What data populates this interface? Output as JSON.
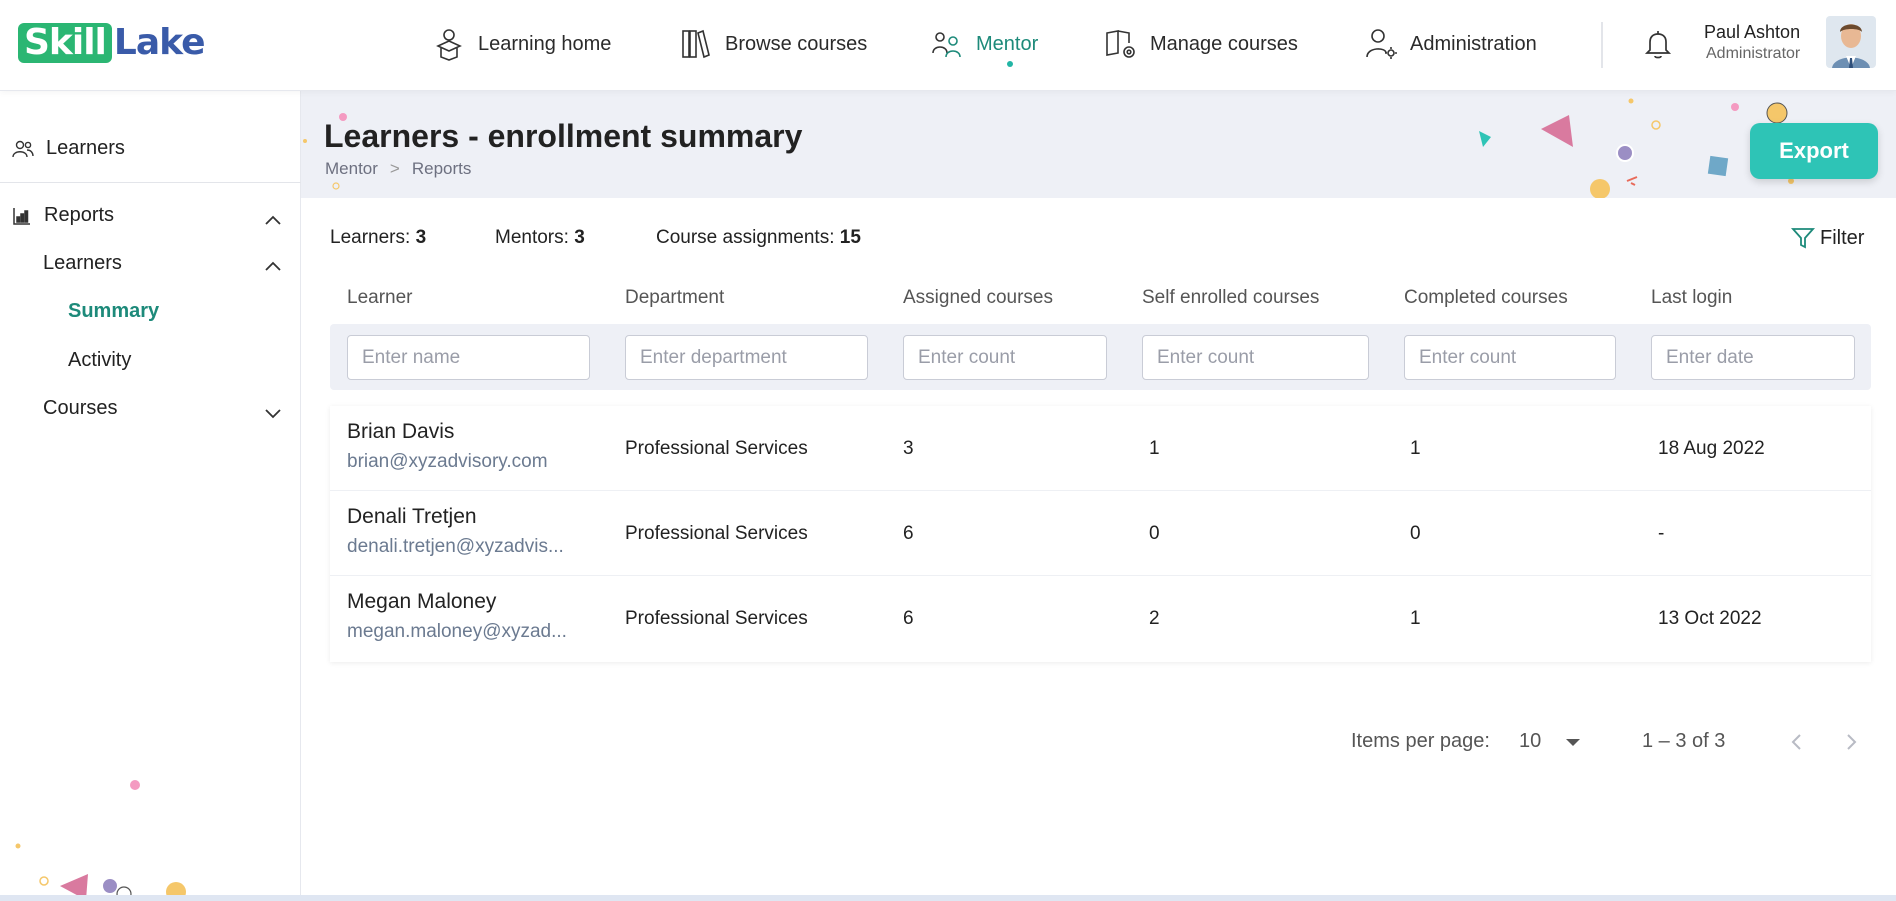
{
  "brand": {
    "part1": "Skill",
    "part2": "Lake"
  },
  "nav": {
    "items": [
      {
        "label": "Learning home",
        "icon": "learning-home-icon"
      },
      {
        "label": "Browse courses",
        "icon": "books-icon"
      },
      {
        "label": "Mentor",
        "icon": "mentor-icon",
        "active": true
      },
      {
        "label": "Manage courses",
        "icon": "manage-courses-icon"
      },
      {
        "label": "Administration",
        "icon": "admin-user-icon"
      }
    ],
    "active_color": "#1d8a7a"
  },
  "user": {
    "name": "Paul Ashton",
    "role": "Administrator"
  },
  "sidebar": {
    "learners": "Learners",
    "reports": "Reports",
    "reports_learners": "Learners",
    "summary": "Summary",
    "activity": "Activity",
    "courses": "Courses"
  },
  "page": {
    "title": "Learners - enrollment summary",
    "breadcrumb": [
      "Mentor",
      "Reports"
    ],
    "breadcrumb_sep": ">",
    "export_label": "Export"
  },
  "stats": {
    "learners_label": "Learners:",
    "learners_value": "3",
    "mentors_label": "Mentors:",
    "mentors_value": "3",
    "assignments_label": "Course assignments:",
    "assignments_value": "15",
    "filter_label": "Filter"
  },
  "table": {
    "headers": [
      "Learner",
      "Department",
      "Assigned courses",
      "Self enrolled courses",
      "Completed courses",
      "Last login"
    ],
    "placeholders": [
      "Enter name",
      "Enter department",
      "Enter count",
      "Enter count",
      "Enter count",
      "Enter date"
    ],
    "rows": [
      {
        "name": "Brian Davis",
        "email": "brian@xyzadvisory.com",
        "department": "Professional Services",
        "assigned": "3",
        "self_enrolled": "1",
        "completed": "1",
        "last_login": "18 Aug 2022"
      },
      {
        "name": "Denali Tretjen",
        "email": "denali.tretjen@xyzadvis...",
        "department": "Professional Services",
        "assigned": "6",
        "self_enrolled": "0",
        "completed": "0",
        "last_login": "-"
      },
      {
        "name": "Megan Maloney",
        "email": "megan.maloney@xyzad...",
        "department": "Professional Services",
        "assigned": "6",
        "self_enrolled": "2",
        "completed": "1",
        "last_login": "13 Oct 2022"
      }
    ]
  },
  "pagination": {
    "items_per_page_label": "Items per page:",
    "page_size": "10",
    "range": "1 – 3 of 3"
  },
  "colors": {
    "accent": "#2ec4b6",
    "brand_green": "#2bb673",
    "brand_blue": "#3a5ba9",
    "band": "#eef0f6"
  }
}
